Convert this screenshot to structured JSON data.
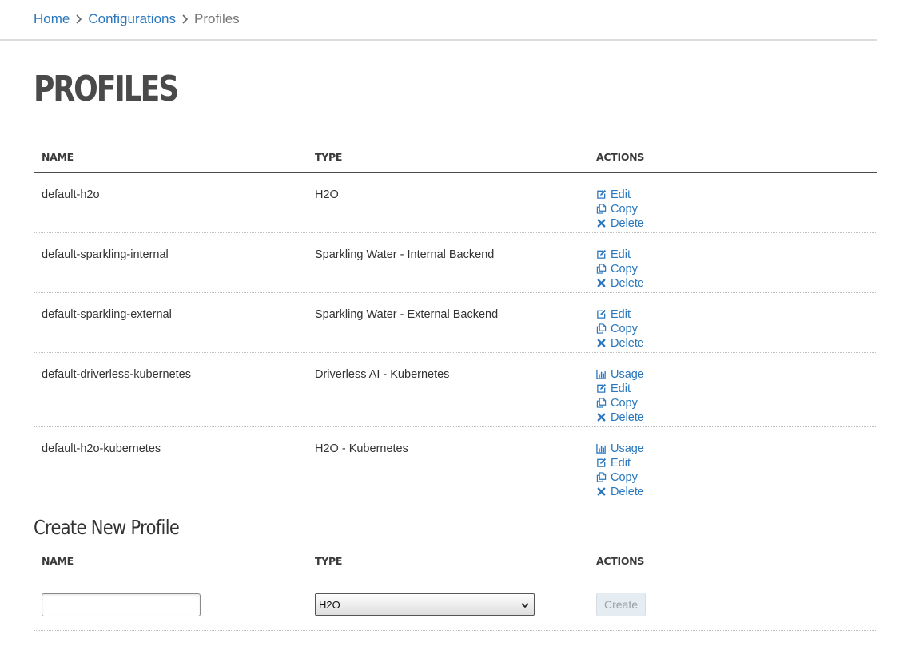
{
  "breadcrumb": {
    "items": [
      {
        "label": "Home"
      },
      {
        "label": "Configurations"
      }
    ],
    "current": "Profiles"
  },
  "page_title": "PROFILES",
  "profiles_table": {
    "headers": {
      "name": "NAME",
      "type": "TYPE",
      "actions": "ACTIONS"
    },
    "rows": [
      {
        "name": "default-h2o",
        "type": "H2O",
        "actions": [
          "Edit",
          "Copy",
          "Delete"
        ]
      },
      {
        "name": "default-sparkling-internal",
        "type": "Sparkling Water - Internal Backend",
        "actions": [
          "Edit",
          "Copy",
          "Delete"
        ]
      },
      {
        "name": "default-sparkling-external",
        "type": "Sparkling Water - External Backend",
        "actions": [
          "Edit",
          "Copy",
          "Delete"
        ]
      },
      {
        "name": "default-driverless-kubernetes",
        "type": "Driverless AI - Kubernetes",
        "actions": [
          "Usage",
          "Edit",
          "Copy",
          "Delete"
        ]
      },
      {
        "name": "default-h2o-kubernetes",
        "type": "H2O - Kubernetes",
        "actions": [
          "Usage",
          "Edit",
          "Copy",
          "Delete"
        ]
      }
    ]
  },
  "create_section": {
    "title": "Create New Profile",
    "headers": {
      "name": "NAME",
      "type": "TYPE",
      "actions": "ACTIONS"
    },
    "name_value": "",
    "type_selected": "H2O",
    "create_label": "Create"
  },
  "colors": {
    "link": "#2a77bd",
    "title": "#4a4a4a",
    "disabled_button_bg": "#e6edf2"
  },
  "icons": {
    "Usage": "bar-chart-icon",
    "Edit": "edit-icon",
    "Copy": "copy-icon",
    "Delete": "delete-x-icon"
  }
}
